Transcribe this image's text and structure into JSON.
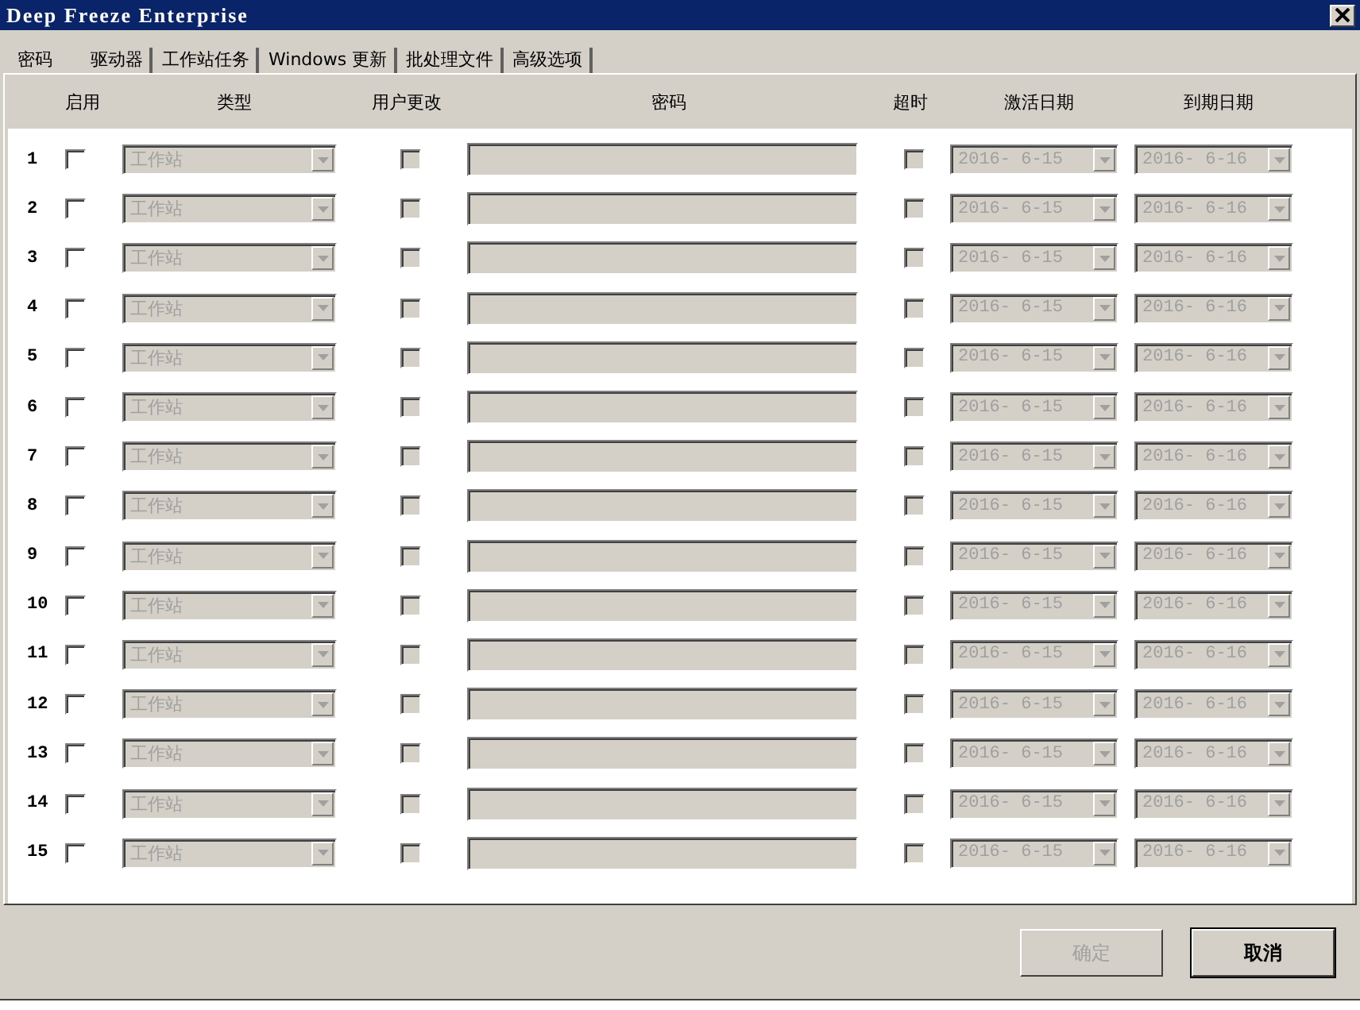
{
  "window": {
    "title": "Deep Freeze Enterprise"
  },
  "tabs": [
    {
      "label": "密码",
      "selected": true
    },
    {
      "label": "驱动器",
      "selected": false
    },
    {
      "label": "工作站任务",
      "selected": false
    },
    {
      "label": "Windows 更新",
      "selected": false
    },
    {
      "label": "批处理文件",
      "selected": false
    },
    {
      "label": "高级选项",
      "selected": false
    }
  ],
  "table": {
    "columns": [
      "启用",
      "类型",
      "用户更改",
      "密码",
      "超时",
      "激活日期",
      "到期日期"
    ],
    "rows": [
      {
        "number": "1",
        "enabled": false,
        "type": "工作站",
        "user_change": false,
        "timeout": false,
        "activation": "2016- 6-15",
        "expiry": "2016- 6-16",
        "disabled": true
      },
      {
        "number": "2",
        "enabled": false,
        "type": "工作站",
        "user_change": false,
        "timeout": false,
        "activation": "2016- 6-15",
        "expiry": "2016- 6-16",
        "disabled": true
      },
      {
        "number": "3",
        "enabled": false,
        "type": "工作站",
        "user_change": false,
        "timeout": false,
        "activation": "2016- 6-15",
        "expiry": "2016- 6-16",
        "disabled": true
      },
      {
        "number": "4",
        "enabled": false,
        "type": "工作站",
        "user_change": false,
        "timeout": false,
        "activation": "2016- 6-15",
        "expiry": "2016- 6-16",
        "disabled": true
      },
      {
        "number": "5",
        "enabled": false,
        "type": "工作站",
        "user_change": false,
        "timeout": false,
        "activation": "2016- 6-15",
        "expiry": "2016- 6-16",
        "disabled": true
      },
      {
        "number": "6",
        "enabled": false,
        "type": "工作站",
        "user_change": false,
        "timeout": false,
        "activation": "2016- 6-15",
        "expiry": "2016- 6-16",
        "disabled": true
      },
      {
        "number": "7",
        "enabled": false,
        "type": "工作站",
        "user_change": false,
        "timeout": false,
        "activation": "2016- 6-15",
        "expiry": "2016- 6-16",
        "disabled": true
      },
      {
        "number": "8",
        "enabled": false,
        "type": "工作站",
        "user_change": false,
        "timeout": false,
        "activation": "2016- 6-15",
        "expiry": "2016- 6-16",
        "disabled": true
      },
      {
        "number": "9",
        "enabled": false,
        "type": "工作站",
        "user_change": false,
        "timeout": false,
        "activation": "2016- 6-15",
        "expiry": "2016- 6-16",
        "disabled": true
      },
      {
        "number": "10",
        "enabled": false,
        "type": "工作站",
        "user_change": false,
        "timeout": false,
        "activation": "2016- 6-15",
        "expiry": "2016- 6-16",
        "disabled": true
      },
      {
        "number": "11",
        "enabled": false,
        "type": "工作站",
        "user_change": false,
        "timeout": false,
        "activation": "2016- 6-15",
        "expiry": "2016- 6-16",
        "disabled": true
      },
      {
        "number": "12",
        "enabled": false,
        "type": "工作站",
        "user_change": false,
        "timeout": false,
        "activation": "2016- 6-15",
        "expiry": "2016- 6-16",
        "disabled": true
      },
      {
        "number": "13",
        "enabled": false,
        "type": "工作站",
        "user_change": false,
        "timeout": false,
        "activation": "2016- 6-15",
        "expiry": "2016- 6-16",
        "disabled": true
      },
      {
        "number": "14",
        "enabled": false,
        "type": "工作站",
        "user_change": false,
        "timeout": false,
        "activation": "2016- 6-15",
        "expiry": "2016- 6-16",
        "disabled": true
      },
      {
        "number": "15",
        "enabled": false,
        "type": "工作站",
        "user_change": false,
        "timeout": false,
        "activation": "2016- 6-15",
        "expiry": "2016- 6-16",
        "disabled": true
      }
    ]
  },
  "buttons": [
    {
      "label": "确定",
      "disabled": true,
      "default": false
    },
    {
      "label": "取消",
      "disabled": false,
      "default": true
    }
  ]
}
